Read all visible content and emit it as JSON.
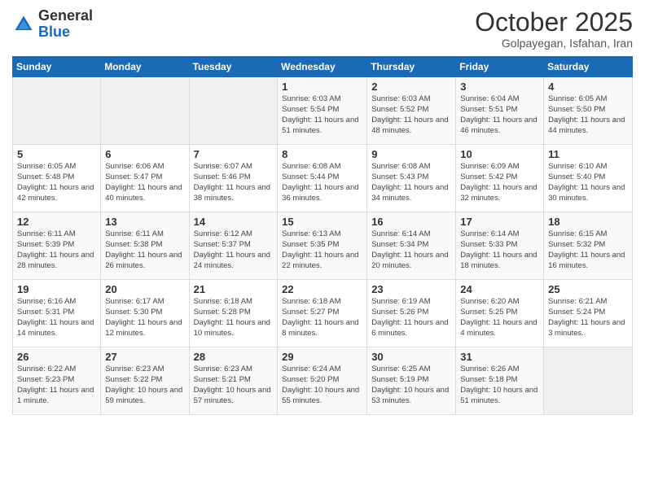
{
  "logo": {
    "general": "General",
    "blue": "Blue"
  },
  "header": {
    "month": "October 2025",
    "location": "Golpayegan, Isfahan, Iran"
  },
  "days_of_week": [
    "Sunday",
    "Monday",
    "Tuesday",
    "Wednesday",
    "Thursday",
    "Friday",
    "Saturday"
  ],
  "weeks": [
    [
      {
        "day": "",
        "info": ""
      },
      {
        "day": "",
        "info": ""
      },
      {
        "day": "",
        "info": ""
      },
      {
        "day": "1",
        "info": "Sunrise: 6:03 AM\nSunset: 5:54 PM\nDaylight: 11 hours and 51 minutes."
      },
      {
        "day": "2",
        "info": "Sunrise: 6:03 AM\nSunset: 5:52 PM\nDaylight: 11 hours and 48 minutes."
      },
      {
        "day": "3",
        "info": "Sunrise: 6:04 AM\nSunset: 5:51 PM\nDaylight: 11 hours and 46 minutes."
      },
      {
        "day": "4",
        "info": "Sunrise: 6:05 AM\nSunset: 5:50 PM\nDaylight: 11 hours and 44 minutes."
      }
    ],
    [
      {
        "day": "5",
        "info": "Sunrise: 6:05 AM\nSunset: 5:48 PM\nDaylight: 11 hours and 42 minutes."
      },
      {
        "day": "6",
        "info": "Sunrise: 6:06 AM\nSunset: 5:47 PM\nDaylight: 11 hours and 40 minutes."
      },
      {
        "day": "7",
        "info": "Sunrise: 6:07 AM\nSunset: 5:46 PM\nDaylight: 11 hours and 38 minutes."
      },
      {
        "day": "8",
        "info": "Sunrise: 6:08 AM\nSunset: 5:44 PM\nDaylight: 11 hours and 36 minutes."
      },
      {
        "day": "9",
        "info": "Sunrise: 6:08 AM\nSunset: 5:43 PM\nDaylight: 11 hours and 34 minutes."
      },
      {
        "day": "10",
        "info": "Sunrise: 6:09 AM\nSunset: 5:42 PM\nDaylight: 11 hours and 32 minutes."
      },
      {
        "day": "11",
        "info": "Sunrise: 6:10 AM\nSunset: 5:40 PM\nDaylight: 11 hours and 30 minutes."
      }
    ],
    [
      {
        "day": "12",
        "info": "Sunrise: 6:11 AM\nSunset: 5:39 PM\nDaylight: 11 hours and 28 minutes."
      },
      {
        "day": "13",
        "info": "Sunrise: 6:11 AM\nSunset: 5:38 PM\nDaylight: 11 hours and 26 minutes."
      },
      {
        "day": "14",
        "info": "Sunrise: 6:12 AM\nSunset: 5:37 PM\nDaylight: 11 hours and 24 minutes."
      },
      {
        "day": "15",
        "info": "Sunrise: 6:13 AM\nSunset: 5:35 PM\nDaylight: 11 hours and 22 minutes."
      },
      {
        "day": "16",
        "info": "Sunrise: 6:14 AM\nSunset: 5:34 PM\nDaylight: 11 hours and 20 minutes."
      },
      {
        "day": "17",
        "info": "Sunrise: 6:14 AM\nSunset: 5:33 PM\nDaylight: 11 hours and 18 minutes."
      },
      {
        "day": "18",
        "info": "Sunrise: 6:15 AM\nSunset: 5:32 PM\nDaylight: 11 hours and 16 minutes."
      }
    ],
    [
      {
        "day": "19",
        "info": "Sunrise: 6:16 AM\nSunset: 5:31 PM\nDaylight: 11 hours and 14 minutes."
      },
      {
        "day": "20",
        "info": "Sunrise: 6:17 AM\nSunset: 5:30 PM\nDaylight: 11 hours and 12 minutes."
      },
      {
        "day": "21",
        "info": "Sunrise: 6:18 AM\nSunset: 5:28 PM\nDaylight: 11 hours and 10 minutes."
      },
      {
        "day": "22",
        "info": "Sunrise: 6:18 AM\nSunset: 5:27 PM\nDaylight: 11 hours and 8 minutes."
      },
      {
        "day": "23",
        "info": "Sunrise: 6:19 AM\nSunset: 5:26 PM\nDaylight: 11 hours and 6 minutes."
      },
      {
        "day": "24",
        "info": "Sunrise: 6:20 AM\nSunset: 5:25 PM\nDaylight: 11 hours and 4 minutes."
      },
      {
        "day": "25",
        "info": "Sunrise: 6:21 AM\nSunset: 5:24 PM\nDaylight: 11 hours and 3 minutes."
      }
    ],
    [
      {
        "day": "26",
        "info": "Sunrise: 6:22 AM\nSunset: 5:23 PM\nDaylight: 11 hours and 1 minute."
      },
      {
        "day": "27",
        "info": "Sunrise: 6:23 AM\nSunset: 5:22 PM\nDaylight: 10 hours and 59 minutes."
      },
      {
        "day": "28",
        "info": "Sunrise: 6:23 AM\nSunset: 5:21 PM\nDaylight: 10 hours and 57 minutes."
      },
      {
        "day": "29",
        "info": "Sunrise: 6:24 AM\nSunset: 5:20 PM\nDaylight: 10 hours and 55 minutes."
      },
      {
        "day": "30",
        "info": "Sunrise: 6:25 AM\nSunset: 5:19 PM\nDaylight: 10 hours and 53 minutes."
      },
      {
        "day": "31",
        "info": "Sunrise: 6:26 AM\nSunset: 5:18 PM\nDaylight: 10 hours and 51 minutes."
      },
      {
        "day": "",
        "info": ""
      }
    ]
  ]
}
